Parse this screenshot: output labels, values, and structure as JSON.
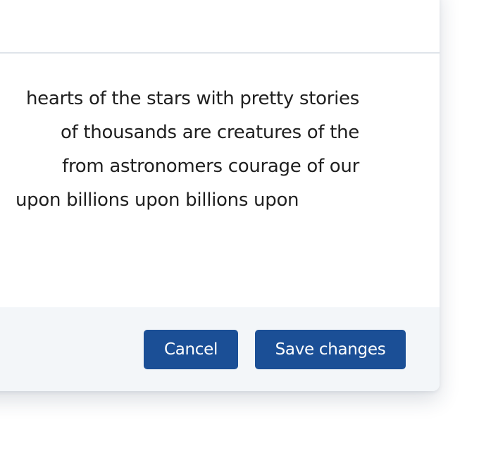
{
  "modal": {
    "body_lines": [
      "hearts of the stars with pretty stories",
      "of thousands are creatures of the",
      "from astronomers courage of our",
      "upon billions upon billions upon"
    ],
    "footer": {
      "cancel_label": "Cancel",
      "save_label": "Save changes"
    },
    "colors": {
      "primary_button": "#1b4f96",
      "footer_background": "#f3f6f9",
      "divider": "#dfe4ea"
    }
  }
}
